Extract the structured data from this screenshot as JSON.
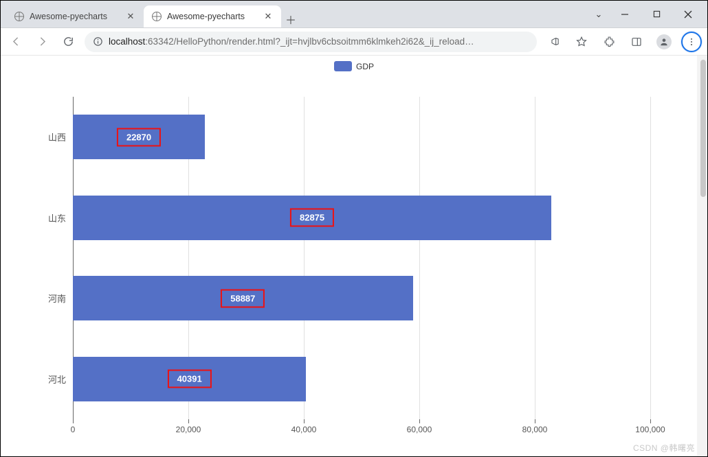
{
  "window": {
    "tabs": [
      {
        "title": "Awesome-pyecharts",
        "active": false
      },
      {
        "title": "Awesome-pyecharts",
        "active": true
      }
    ]
  },
  "address": {
    "host": "localhost",
    "rest": ":63342/HelloPython/render.html?_ijt=hvjlbv6cbsoitmm6klmkeh2i62&_ij_reload…"
  },
  "legend": {
    "label": "GDP"
  },
  "colors": {
    "series": "#5470c6"
  },
  "watermark": "CSDN @韩曙亮",
  "chart_data": {
    "type": "bar",
    "orientation": "horizontal",
    "series_name": "GDP",
    "categories": [
      "山西",
      "山东",
      "河南",
      "河北"
    ],
    "values": [
      22870,
      82875,
      58887,
      40391
    ],
    "value_labels": [
      "22870",
      "82875",
      "58887",
      "40391"
    ],
    "xlabel": "",
    "ylabel": "",
    "xlim": [
      0,
      100000
    ],
    "x_ticks": [
      0,
      20000,
      40000,
      60000,
      80000,
      100000
    ],
    "x_tick_labels": [
      "0",
      "20,000",
      "40,000",
      "60,000",
      "80,000",
      "100,000"
    ],
    "labels_highlighted": true
  }
}
